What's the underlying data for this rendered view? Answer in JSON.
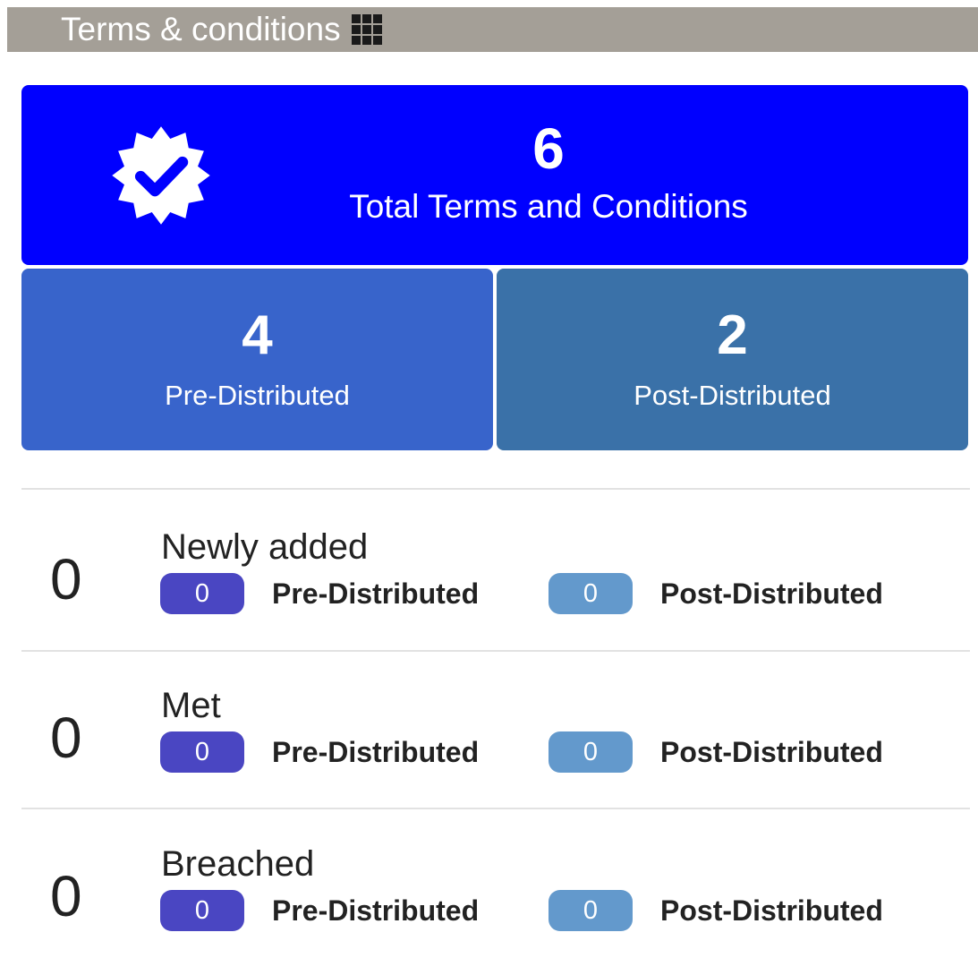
{
  "header": {
    "title": "Terms & conditions",
    "icon": "grid-icon"
  },
  "summary": {
    "total": {
      "value": "6",
      "label": "Total Terms and Conditions",
      "icon": "verified-badge-icon",
      "color": "#0000ff"
    },
    "pre_distributed": {
      "value": "4",
      "label": "Pre-Distributed",
      "color": "#3864cb"
    },
    "post_distributed": {
      "value": "2",
      "label": "Post-Distributed",
      "color": "#3a71a8"
    }
  },
  "stats": [
    {
      "count": "0",
      "title": "Newly added",
      "pre_count": "0",
      "pre_label": "Pre-Distributed",
      "post_count": "0",
      "post_label": "Post-Distributed"
    },
    {
      "count": "0",
      "title": "Met",
      "pre_count": "0",
      "pre_label": "Pre-Distributed",
      "post_count": "0",
      "post_label": "Post-Distributed"
    },
    {
      "count": "0",
      "title": "Breached",
      "pre_count": "0",
      "pre_label": "Pre-Distributed",
      "post_count": "0",
      "post_label": "Post-Distributed"
    }
  ],
  "colors": {
    "header_bg": "#a49f97",
    "pre_pill": "#4a46c2",
    "post_pill": "#6399cc"
  }
}
